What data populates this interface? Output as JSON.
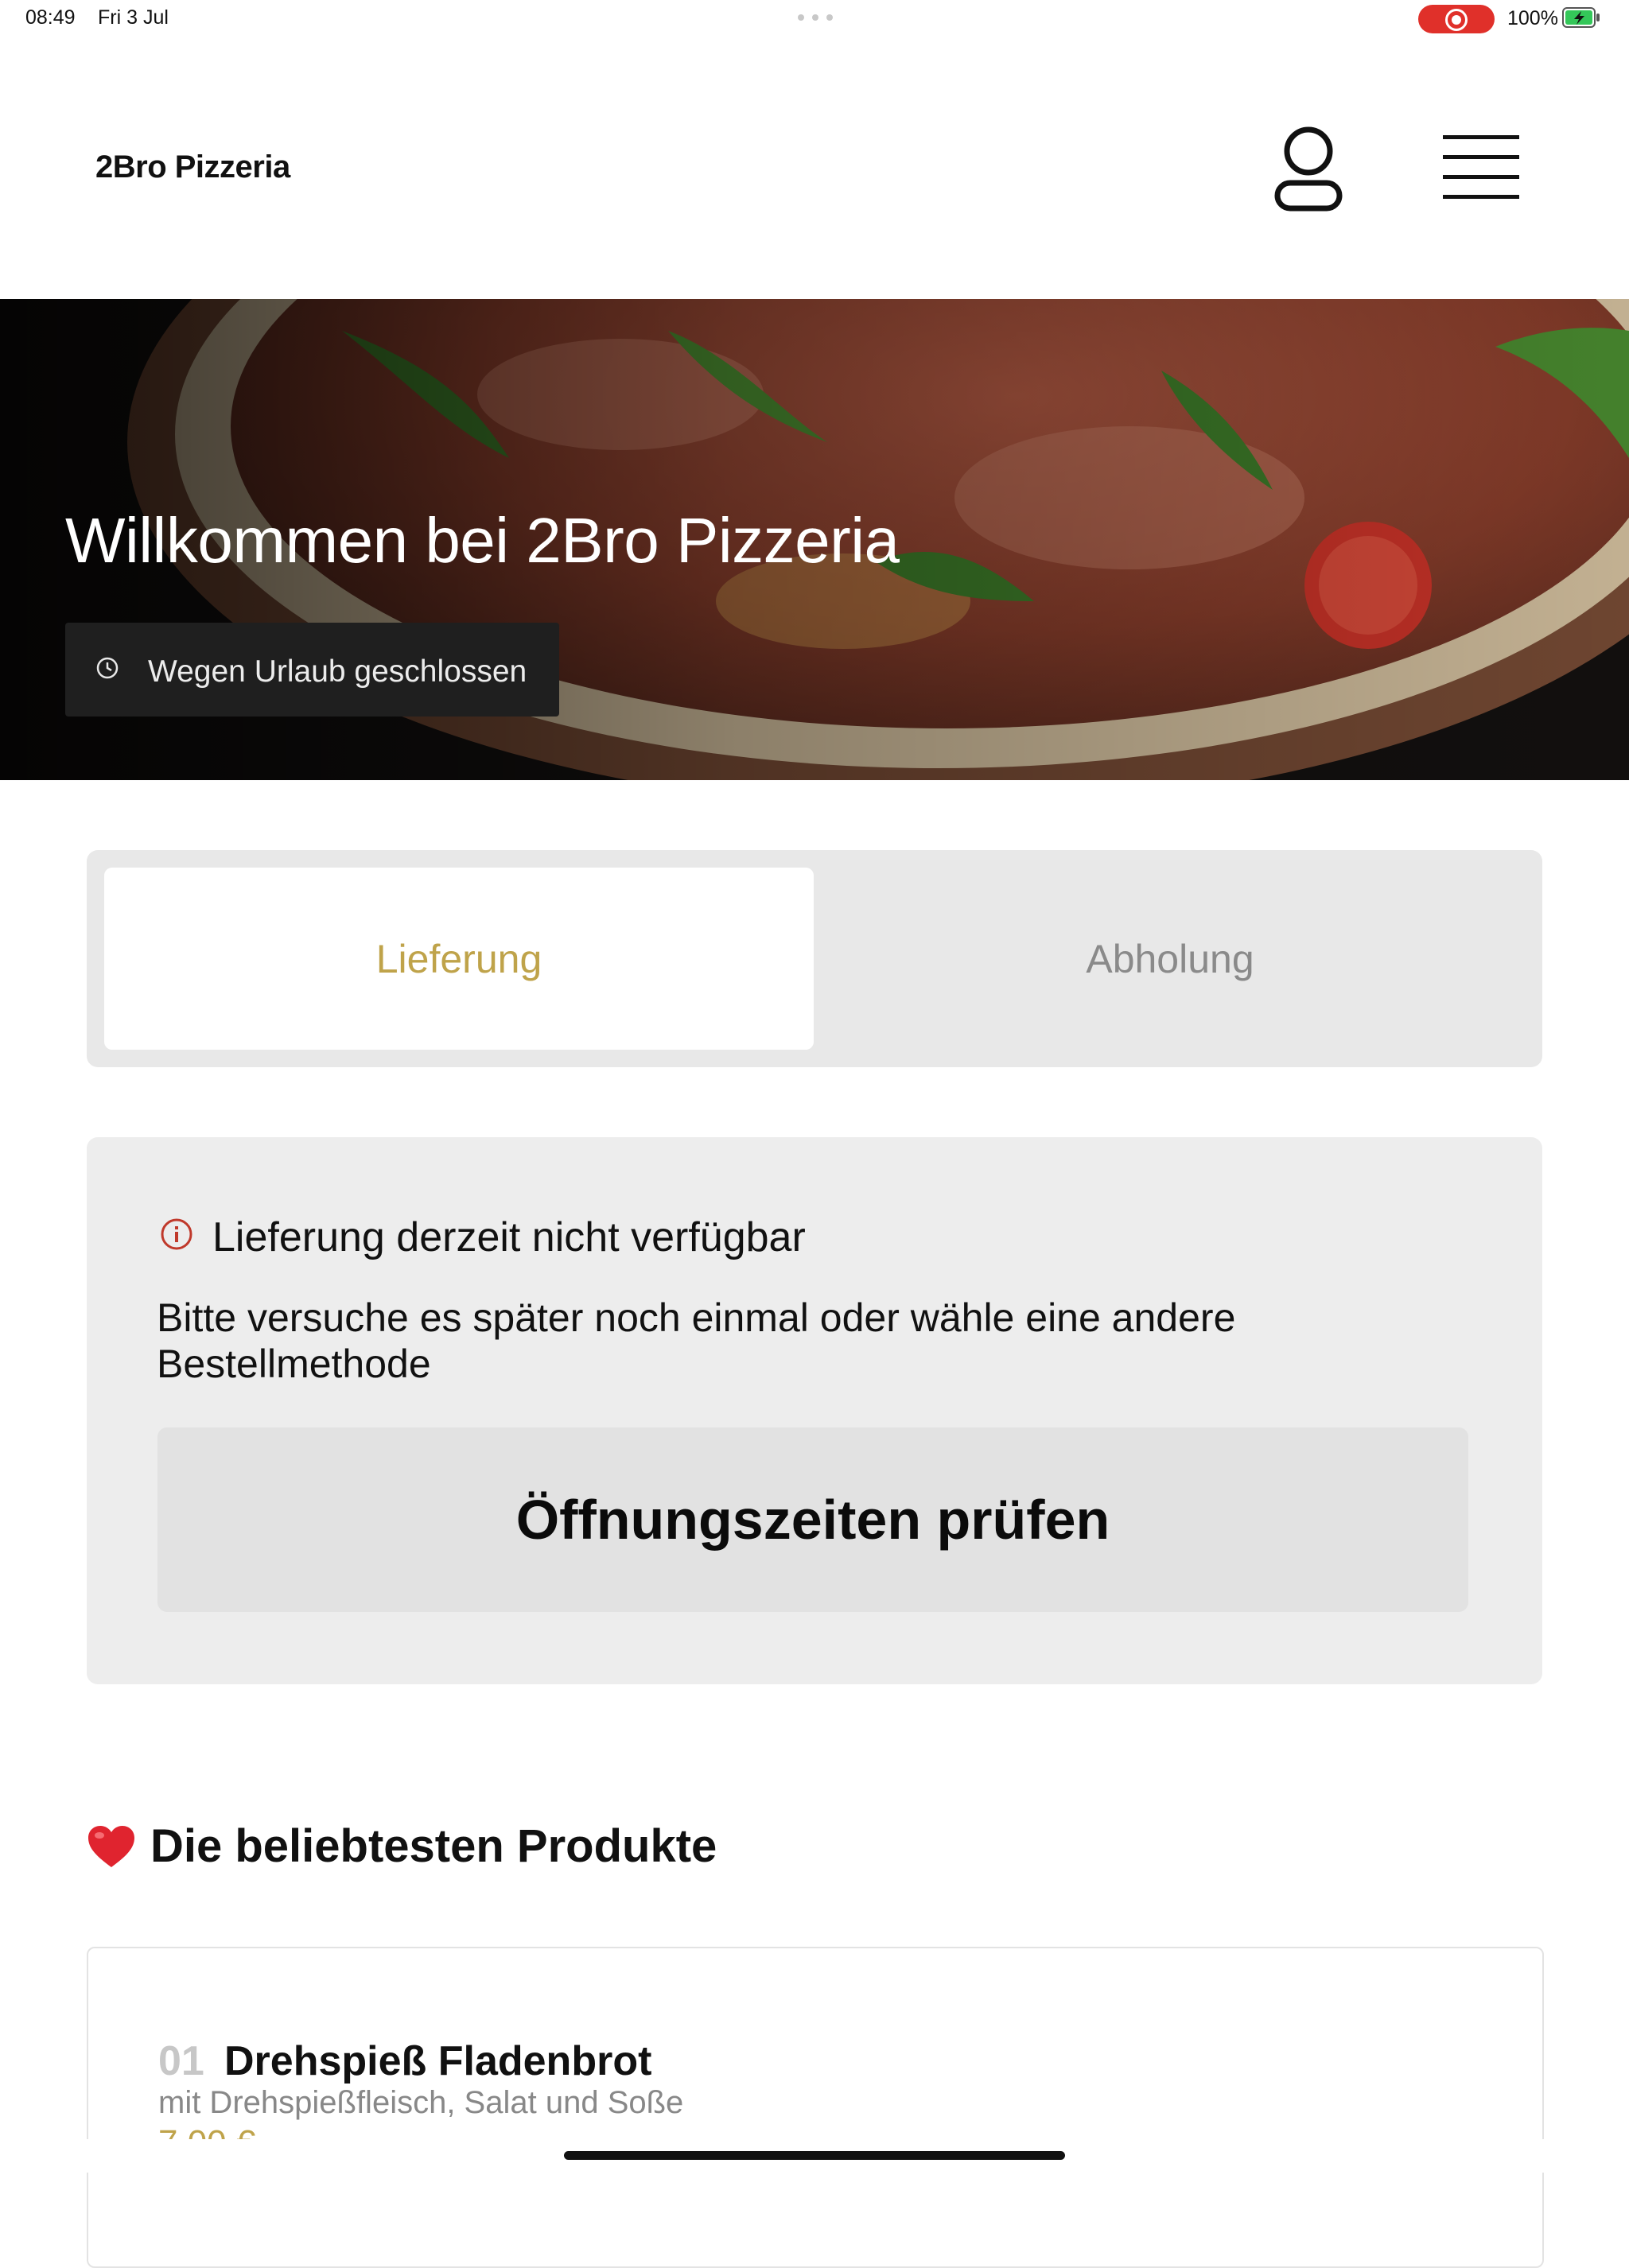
{
  "status_bar": {
    "time": "08:49",
    "date": "Fri 3 Jul",
    "battery": "100%"
  },
  "header": {
    "brand": "2Bro Pizzeria",
    "account_icon": "user-icon",
    "menu_icon": "hamburger-menu-icon"
  },
  "hero": {
    "title": "Willkommen bei 2Bro Pizzeria",
    "status": "Wegen Urlaub geschlossen",
    "status_icon": "clock-icon"
  },
  "order_method": {
    "options": [
      "Lieferung",
      "Abholung"
    ],
    "selected": "Lieferung"
  },
  "notice": {
    "icon": "info-icon",
    "title": "Lieferung derzeit nicht verfügbar",
    "message": "Bitte versuche es später noch einmal oder wähle eine andere Bestellmethode",
    "button": "Öffnungszeiten prüfen"
  },
  "popular": {
    "heading": "Die beliebtesten Produkte",
    "items": [
      {
        "number": "01",
        "name": "Drehspieß Fladenbrot",
        "description": "mit Drehspießfleisch, Salat und Soße",
        "price": "7,00 €"
      }
    ]
  },
  "colors": {
    "accent": "#bfa34a",
    "alert": "#c0392b",
    "recording": "#e0302a",
    "battery": "#34c759"
  }
}
